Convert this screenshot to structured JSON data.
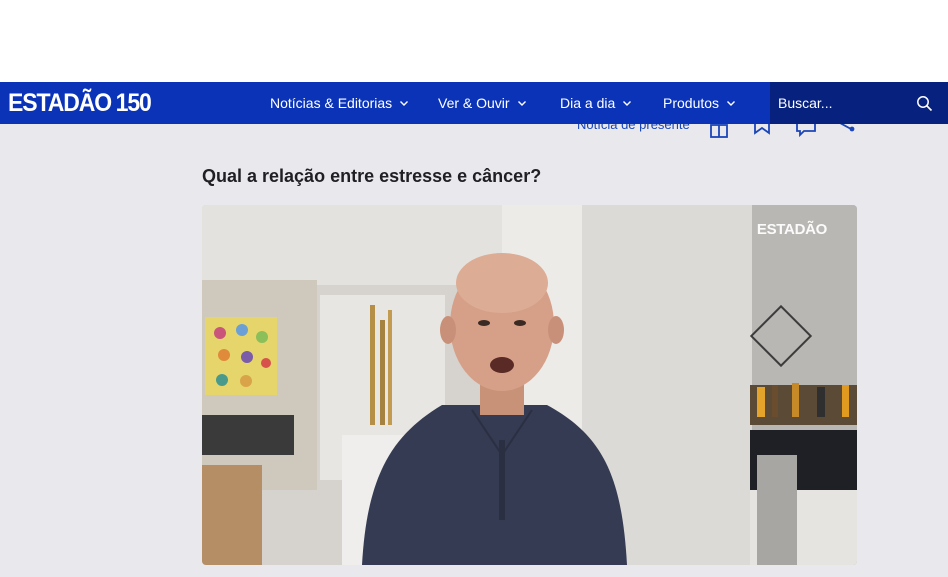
{
  "logo": {
    "text": "ESTADÃO",
    "number": "150"
  },
  "nav": {
    "items": [
      {
        "label": "Notícias & Editorias"
      },
      {
        "label": "Ver & Ouvir"
      },
      {
        "label": "Dia a dia"
      },
      {
        "label": "Produtos"
      }
    ]
  },
  "search": {
    "placeholder": "Buscar..."
  },
  "actions": {
    "gift_label": "Notícia de presente"
  },
  "article": {
    "headline": "Qual a relação entre estresse e câncer?"
  },
  "video": {
    "watermark": "ESTADÃO"
  },
  "colors": {
    "nav_bg": "#0a33b8",
    "search_bg": "#06217e",
    "page_bg": "#e9e9ed",
    "link": "#1a46b8"
  },
  "icons": [
    "chevron-down-icon",
    "search-icon",
    "gift-icon",
    "bookmark-icon",
    "comment-icon",
    "share-icon"
  ]
}
